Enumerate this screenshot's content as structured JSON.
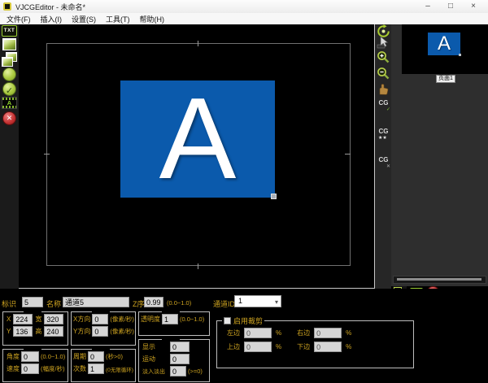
{
  "window": {
    "title": "VJCGEditor - 未命名*",
    "buttons": {
      "min": "–",
      "max": "□",
      "close": "×"
    }
  },
  "menu": {
    "items": [
      "文件(F)",
      "插入(I)",
      "设置(S)",
      "工具(T)",
      "帮助(H)"
    ]
  },
  "left_toolbar": {
    "text_tool_label": "TXT",
    "char_tool_letter": "A"
  },
  "stage": {
    "image_letter": "A"
  },
  "right_toolbar": {
    "cg_label": "CG",
    "cg_check_mark": "✓",
    "cg_stars": "★★",
    "cg_x": "✕"
  },
  "pages": {
    "thumb_letter": "A",
    "page_name": "页面1"
  },
  "form": {
    "id_label": "标识",
    "id_value": "5",
    "name_label": "名称",
    "name_value": "通道5",
    "z_label": "Z序",
    "z_value": "0.99",
    "z_hint": "(0.0~1.0)",
    "channel_label": "通道ID",
    "channel_value": "1",
    "x_label": "X",
    "x_value": "224",
    "w_label": "宽",
    "w_value": "320",
    "y_label": "Y",
    "y_value": "136",
    "h_label": "高",
    "h_value": "240",
    "vx_label": "X方向",
    "vx_value": "0",
    "vy_label": "Y方向",
    "vy_value": "0",
    "v_unit": "(像素/秒)",
    "opacity_label": "透明度",
    "opacity_value": "1",
    "opacity_hint": "(0.0~1.0)",
    "angle_label": "角度",
    "angle_value": "0",
    "angle_hint": "(0.0~1.0)",
    "speed_label": "速度",
    "speed_value": "0",
    "speed_hint": "(幅度/秒)",
    "period_label": "周期",
    "period_value": "0",
    "period_hint": "(秒>0)",
    "times_label": "次数",
    "times_value": "1",
    "times_hint": "(0无限循环)",
    "show_label": "显示",
    "show_value": "0",
    "motion_label": "运动",
    "motion_value": "0",
    "fade_label": "淡入淡出",
    "fade_value": "0",
    "fade_hint": "(>=0)",
    "crop": {
      "title": "启用裁剪",
      "pct": "%",
      "left_label": "左边",
      "left": "0",
      "right_label": "右边",
      "right": "0",
      "top_label": "上边",
      "top": "0",
      "bottom_label": "下边",
      "bottom": "0"
    }
  },
  "colors": {
    "accent": "#9acd32",
    "label_gold": "#cfa420",
    "image_blue": "#0b5aac"
  }
}
